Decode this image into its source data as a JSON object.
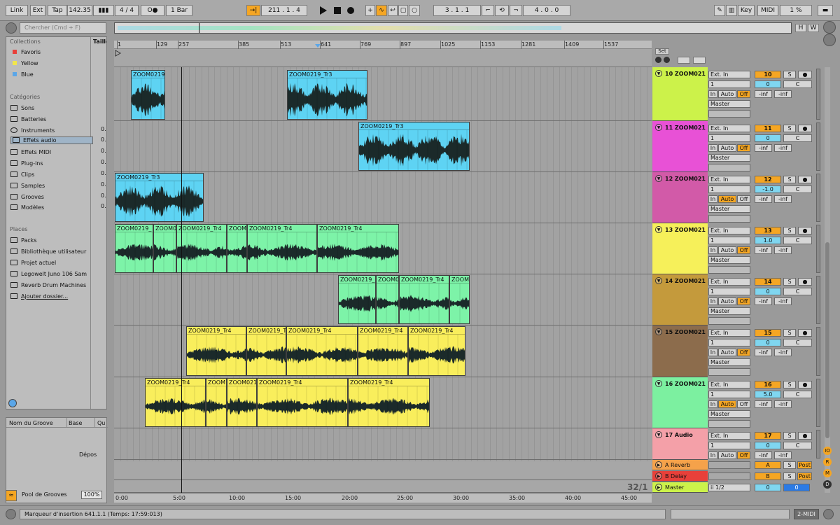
{
  "topbar": {
    "link": "Link",
    "ext": "Ext",
    "tap": "Tap",
    "tempo": "142.35",
    "time_sig": "4 / 4",
    "metronome": "O●",
    "quant": "1 Bar",
    "position": "211 .   1 .   4",
    "loop_start": "3 .   1 .   1",
    "loop_len": "4 .   0 .   0",
    "key": "Key",
    "midi": "MIDI",
    "cpu": "1 %"
  },
  "browser": {
    "search_placeholder": "Chercher (Cmd + F)",
    "col_size": "Taille",
    "collections_title": "Collections",
    "collections": [
      {
        "label": "Favoris",
        "color": "#e8403a"
      },
      {
        "label": "Yellow",
        "color": "#f2e64a"
      },
      {
        "label": "Blue",
        "color": "#5aa6e8"
      }
    ],
    "categories_title": "Catégories",
    "categories": [
      {
        "label": "Sons",
        "size": ""
      },
      {
        "label": "Batteries",
        "size": ""
      },
      {
        "label": "Instruments",
        "size": "0."
      },
      {
        "label": "Effets audio",
        "size": "0."
      },
      {
        "label": "Effets MIDI",
        "size": "0."
      },
      {
        "label": "Plug-ins",
        "size": "0."
      },
      {
        "label": "Clips",
        "size": "0."
      },
      {
        "label": "Samples",
        "size": "0."
      },
      {
        "label": "Grooves",
        "size": "0."
      },
      {
        "label": "Modèles",
        "size": "0."
      }
    ],
    "places_title": "Places",
    "places": [
      {
        "label": "Packs"
      },
      {
        "label": "Bibliothèque utilisateur"
      },
      {
        "label": "Projet actuel"
      },
      {
        "label": "Legowelt Juno 106 Sam"
      },
      {
        "label": "Reverb Drum Machines"
      },
      {
        "label": "Ajouter dossier..."
      }
    ]
  },
  "groove": {
    "col_name": "Nom du Groove",
    "col_base": "Base",
    "col_q": "Qu",
    "drop": "Dépos",
    "pool": "Pool de Grooves",
    "percent": "100%"
  },
  "overview": {
    "h": "H",
    "w": "W"
  },
  "set": {
    "label": "Set"
  },
  "ruler": [
    "1",
    "129",
    "257",
    "385",
    "513",
    "641",
    "769",
    "897",
    "1025",
    "1153",
    "1281",
    "1409",
    "1537"
  ],
  "timeline": [
    "0:00",
    "5:00",
    "10:00",
    "15:00",
    "20:00",
    "25:00",
    "30:00",
    "35:00",
    "40:00",
    "45:00"
  ],
  "counter": "32/1",
  "tracks": [
    {
      "name": "10 ZOOM021",
      "color": "#ccf24a",
      "input": "Ext. In",
      "channel": "1",
      "out": "Master",
      "num": "10",
      "pan": "0",
      "pan_c": "C",
      "monitor": "Off",
      "inf1": "-inf",
      "inf2": "-inf",
      "clips": [
        {
          "name": "ZOOM0219",
          "start": 24,
          "width": 49
        },
        {
          "name": "ZOOM0219_Tr3",
          "start": 247,
          "width": 115
        }
      ]
    },
    {
      "name": "11 ZOOM021",
      "color": "#e851d6",
      "input": "Ext. In",
      "channel": "1",
      "out": "Master",
      "num": "11",
      "pan": "0",
      "pan_c": "C",
      "monitor": "Off",
      "inf1": "-inf",
      "inf2": "-inf",
      "clips": [
        {
          "name": "ZOOM0219_Tr3",
          "start": 349,
          "width": 159
        }
      ]
    },
    {
      "name": "12 ZOOM021",
      "color": "#d25aa8",
      "input": "Ext. In",
      "channel": "1",
      "out": "Master",
      "num": "12",
      "pan": "-1.0",
      "pan_c": "C",
      "monitor": "Auto",
      "inf1": "-inf",
      "inf2": "-inf",
      "clips": [
        {
          "name": "ZOOM0219_Tr3",
          "start": 1,
          "width": 127
        }
      ]
    },
    {
      "name": "13 ZOOM021",
      "color": "#f6f05a",
      "input": "Ext. In",
      "channel": "1",
      "out": "Master",
      "num": "13",
      "pan": "1.0",
      "pan_c": "C",
      "monitor": "Off",
      "inf1": "-inf",
      "inf2": "-inf",
      "clips": [
        {
          "name": "ZOOM0219_",
          "start": 1,
          "width": 55
        },
        {
          "name": "ZOOM0",
          "start": 56,
          "width": 33
        },
        {
          "name": "ZOOM0219_Tr4",
          "start": 89,
          "width": 72
        },
        {
          "name": "ZOOM0",
          "start": 161,
          "width": 29
        },
        {
          "name": "ZOOM0219_Tr4",
          "start": 190,
          "width": 100
        },
        {
          "name": "ZOOM0219_Tr4",
          "start": 290,
          "width": 117
        }
      ]
    },
    {
      "name": "14 ZOOM021",
      "color": "#c49a3c",
      "input": "Ext. In",
      "channel": "1",
      "out": "Master",
      "num": "14",
      "pan": "0",
      "pan_c": "C",
      "monitor": "Off",
      "inf1": "-inf",
      "inf2": "-inf",
      "clips": [
        {
          "name": "ZOOM0219_",
          "start": 320,
          "width": 54
        },
        {
          "name": "ZOOM0",
          "start": 374,
          "width": 33
        },
        {
          "name": "ZOOM0219_Tr4",
          "start": 407,
          "width": 72
        },
        {
          "name": "ZOOM0",
          "start": 479,
          "width": 29
        }
      ]
    },
    {
      "name": "15 ZOOM021",
      "color": "#8c6c4c",
      "input": "Ext. In",
      "channel": "1",
      "out": "Master",
      "num": "15",
      "pan": "0",
      "pan_c": "C",
      "monitor": "Off",
      "inf1": "-inf",
      "inf2": "-inf",
      "clips": [
        {
          "name": "ZOOM0219_Tr4",
          "start": 103,
          "width": 86
        },
        {
          "name": "ZOOM0219_T",
          "start": 189,
          "width": 57
        },
        {
          "name": "ZOOM0219_Tr4",
          "start": 246,
          "width": 102
        },
        {
          "name": "ZOOM0219_Tr4",
          "start": 348,
          "width": 72
        },
        {
          "name": "ZOOM0219_Tr4",
          "start": 420,
          "width": 82
        }
      ]
    },
    {
      "name": "16 ZOOM021",
      "color": "#7cf0a0",
      "input": "Ext. In",
      "channel": "1",
      "out": "Master",
      "num": "16",
      "pan": "5.0",
      "pan_c": "C",
      "monitor": "Auto",
      "inf1": "-inf",
      "inf2": "-inf",
      "clips": [
        {
          "name": "ZOOM0219_Tr4",
          "start": 44,
          "width": 87
        },
        {
          "name": "ZOOM",
          "start": 131,
          "width": 30
        },
        {
          "name": "ZOOM021",
          "start": 161,
          "width": 43
        },
        {
          "name": "ZOOM0219_Tr4",
          "start": 204,
          "width": 130
        },
        {
          "name": "ZOOM0219_Tr4",
          "start": 334,
          "width": 117
        }
      ]
    },
    {
      "name": "17 Audio",
      "color": "#f4a0a8",
      "input": "Ext. In",
      "channel": "1",
      "out": "Master",
      "num": "17",
      "pan": "0",
      "pan_c": "C",
      "monitor": "Off",
      "inf1": "-inf",
      "inf2": "-inf",
      "clips": []
    }
  ],
  "returns": [
    {
      "name": "A Reverb",
      "color": "#f5a24a",
      "letter": "A",
      "s": "S",
      "post": "Post"
    },
    {
      "name": "B Delay",
      "color": "#e8403a",
      "letter": "B",
      "s": "S",
      "post": "Post"
    },
    {
      "name": "Master",
      "color": "#ccf24a",
      "letter": "0",
      "s": "",
      "post": "0",
      "sel": "ii 1/2"
    }
  ],
  "status": {
    "text": "Marqueur d'insertion 641.1.1 (Temps: 17:59:013)",
    "midi": "2-MIDI"
  },
  "colors": {
    "orange": "#f5a623",
    "blue_clip": "#5ed3f3",
    "green_clip": "#7df3a8",
    "yellow_clip": "#f9ee5c"
  }
}
